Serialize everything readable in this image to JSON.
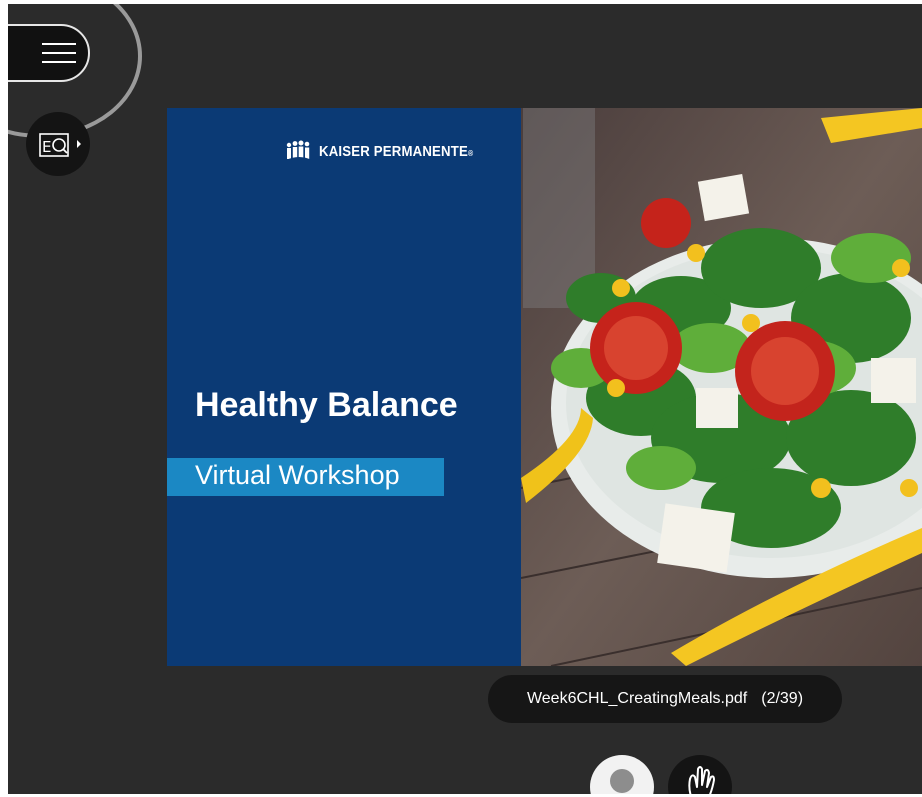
{
  "toolbar": {
    "menu_icon": "hamburger-icon",
    "captions_icon": "closed-captions-icon"
  },
  "slide": {
    "brand": "KAISER PERMANENTE",
    "brand_mark": "®",
    "title": "Healthy Balance",
    "subtitle": "Virtual Workshop",
    "colors": {
      "navy": "#0b3a75",
      "subtitle_bar": "#1b88c4"
    }
  },
  "file": {
    "name": "Week6CHL_CreatingMeals.pdf",
    "pages": "(2/39)"
  },
  "bottom_bar": {
    "avatar_icon": "user-avatar-icon",
    "raise_hand_icon": "raise-hand-icon"
  }
}
